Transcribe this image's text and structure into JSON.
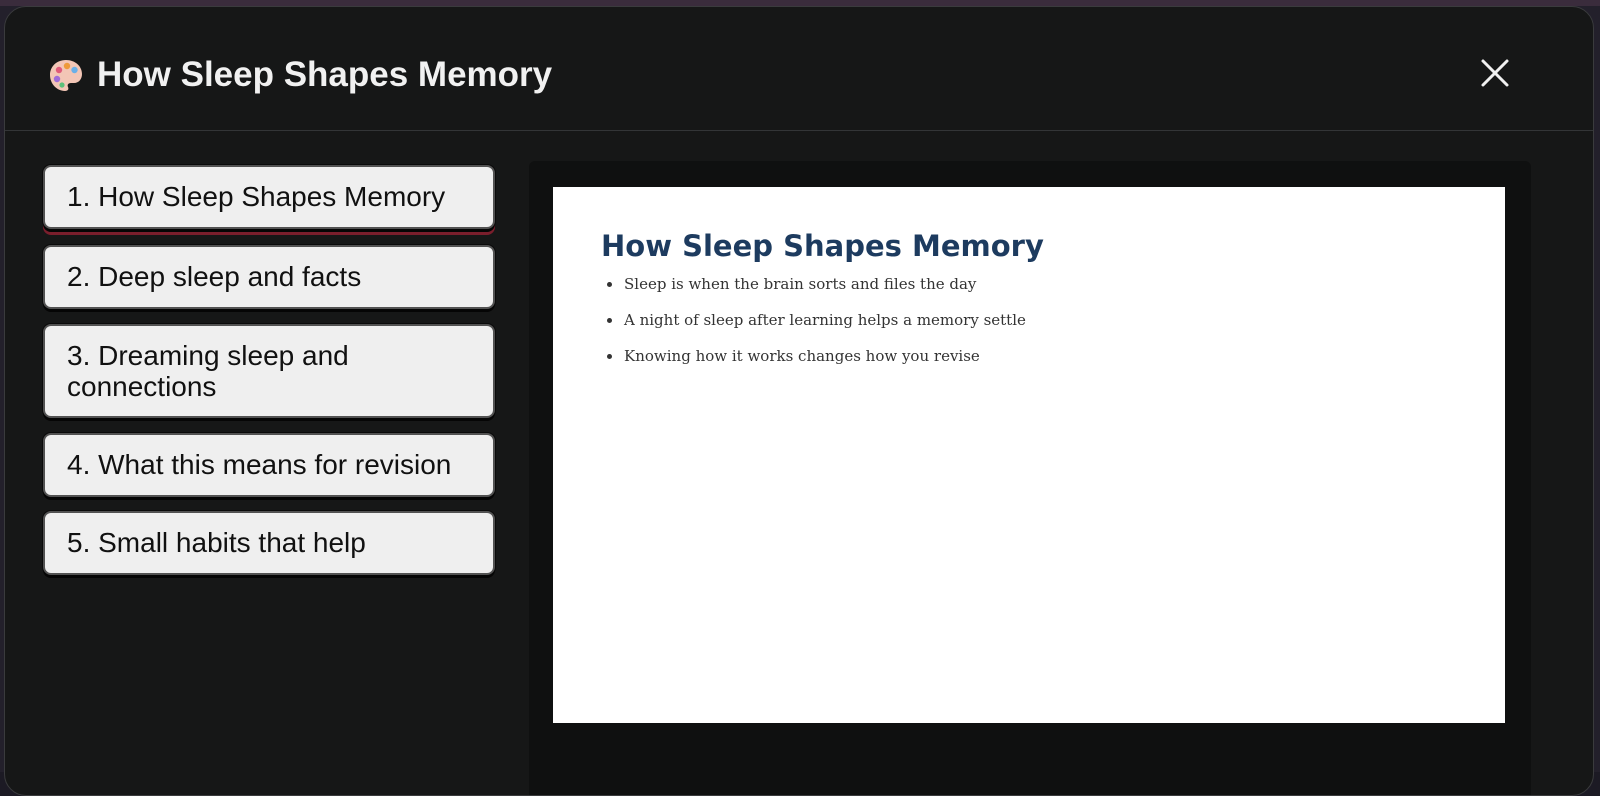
{
  "dialog": {
    "icon": "palette-icon",
    "title": "How Sleep Shapes Memory",
    "close_icon": "close-icon"
  },
  "nav": {
    "items": [
      {
        "label": "1. How Sleep Shapes Memory",
        "active": true
      },
      {
        "label": "2. Deep sleep and facts",
        "active": false
      },
      {
        "label": "3. Dreaming sleep and connections",
        "active": false
      },
      {
        "label": "4. What this means for revision",
        "active": false
      },
      {
        "label": "5. Small habits that help",
        "active": false
      }
    ]
  },
  "slide": {
    "title": "How Sleep Shapes Memory",
    "bullets": [
      "Sleep is when the brain sorts and files the day",
      "A night of sleep after learning helps a memory settle",
      "Knowing how it works changes how you revise"
    ]
  },
  "colors": {
    "dialog_background": "#161717",
    "nav_item_background": "#efefef",
    "active_underline": "#7a1e2c",
    "slide_title": "#1d3b5f"
  }
}
